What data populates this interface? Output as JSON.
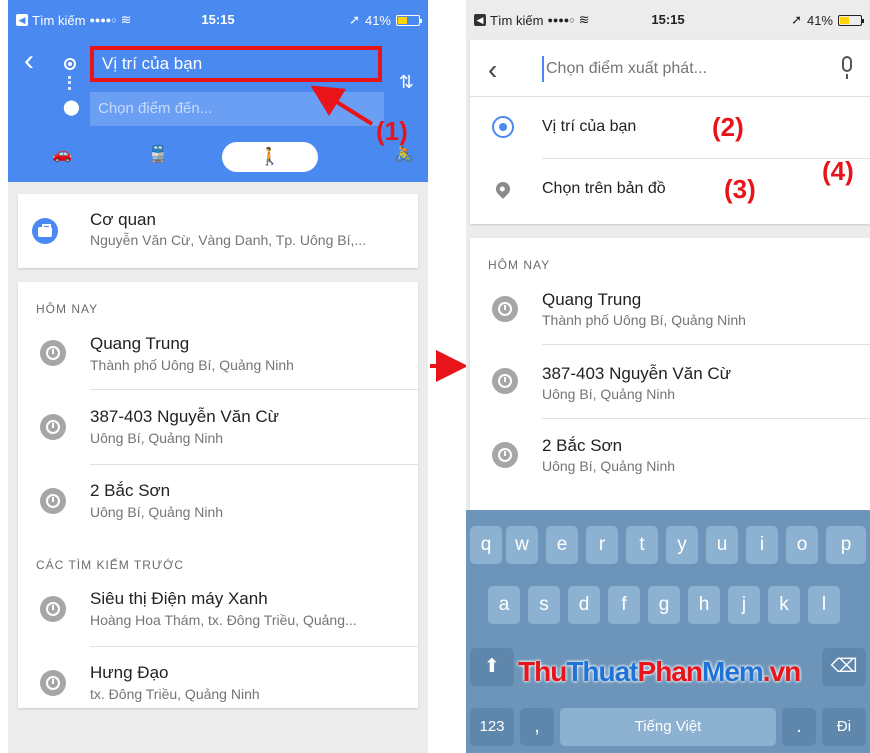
{
  "status": {
    "back_app": "Tìm kiếm",
    "signal": "●●●●○",
    "time": "15:15",
    "battery": "41%"
  },
  "left": {
    "origin_value": "Vị trí của bạn",
    "destination_placeholder": "Chọn điểm đến...",
    "work": {
      "title": "Cơ quan",
      "subtitle": "Nguyễn Văn Cừ, Vàng Danh, Tp. Uông Bí,..."
    },
    "today_header": "HÔM NAY",
    "today": [
      {
        "title": "Quang Trung",
        "subtitle": "Thành phố Uông Bí, Quảng Ninh"
      },
      {
        "title": "387-403 Nguyễn Văn Cừ",
        "subtitle": "Uông Bí, Quảng Ninh"
      },
      {
        "title": "2 Bắc Sơn",
        "subtitle": "Uông Bí, Quảng Ninh"
      }
    ],
    "previous_header": "CÁC TÌM KIẾM TRƯỚC",
    "previous": [
      {
        "title": "Siêu thị Điện máy Xanh",
        "subtitle": "Hoàng Hoa Thám, tx. Đông Triều, Quảng..."
      },
      {
        "title": "Hưng Đạo",
        "subtitle": "tx. Đông Triều, Quảng Ninh"
      }
    ]
  },
  "right": {
    "start_placeholder": "Chọn điểm xuất phát...",
    "your_location": "Vị trí của bạn",
    "choose_on_map": "Chọn trên bản đồ",
    "today_header": "HÔM NAY",
    "today": [
      {
        "title": "Quang Trung",
        "subtitle": "Thành phố Uông Bí, Quảng Ninh"
      },
      {
        "title": "387-403 Nguyễn Văn Cừ",
        "subtitle": "Uông Bí, Quảng Ninh"
      },
      {
        "title": "2 Bắc Sơn",
        "subtitle": "Uông Bí, Quảng Ninh"
      }
    ]
  },
  "keyboard": {
    "row1": [
      "q",
      "w",
      "e",
      "r",
      "t",
      "y",
      "u",
      "i",
      "o",
      "p"
    ],
    "row2": [
      "a",
      "s",
      "d",
      "f",
      "g",
      "h",
      "j",
      "k",
      "l"
    ],
    "numbers_key": "123",
    "comma_key": ",",
    "space_label": "Tiếng Việt",
    "period_key": ".",
    "go_key": "Đi"
  },
  "annotations": {
    "a1": "(1)",
    "a2": "(2)",
    "a3": "(3)",
    "a4": "(4)"
  },
  "watermark": {
    "part_a": "Thu",
    "part_b": "Thuat",
    "part_c": "Phan",
    "part_d": "Mem",
    "part_e": ".vn"
  },
  "icons": [
    "back-arrow-icon",
    "swap-icon",
    "car-icon",
    "transit-icon",
    "walk-icon",
    "bike-icon",
    "briefcase-icon",
    "clock-icon",
    "my-location-icon",
    "pin-icon",
    "mic-icon",
    "shift-icon",
    "delete-icon"
  ],
  "colors": {
    "accent_blue": "#4a89f0",
    "annotation_red": "#e8141a"
  }
}
